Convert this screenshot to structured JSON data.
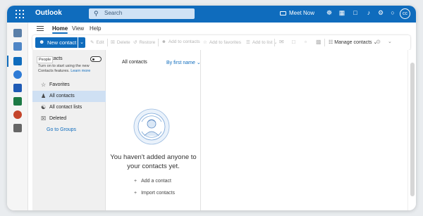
{
  "app": {
    "title": "Outlook",
    "search_placeholder": "Search",
    "meet_now_label": "Meet Now",
    "avatar_initials": "cc",
    "accent": "#0f6cbd"
  },
  "ribbon": {
    "tabs": [
      "Home",
      "View",
      "Help"
    ],
    "active_tab": "Home"
  },
  "toolbar": {
    "new_contact": "New contact",
    "edit": "Edit",
    "delete": "Delete",
    "restore": "Restore",
    "add_to_contacts": "Add to contacts",
    "add_to_favorites": "Add to favorites",
    "add_to_list": "Add to list",
    "manage_contacts": "Manage contacts"
  },
  "left_pane": {
    "people_tooltip": "People",
    "toggle_title": "ntacts",
    "toggle_desc_1": "Turn on to start using the new Contacts",
    "toggle_desc_2": "features.",
    "learn_more": "Learn more",
    "nav": [
      {
        "label": "Favorites",
        "icon": "star-icon"
      },
      {
        "label": "All contacts",
        "icon": "person-icon"
      },
      {
        "label": "All contact lists",
        "icon": "people-list-icon"
      },
      {
        "label": "Deleted",
        "icon": "trash-icon"
      }
    ],
    "selected": "All contacts",
    "groups_link": "Go to Groups"
  },
  "list_pane": {
    "title": "All contacts",
    "sort": "By first name",
    "empty_line1": "You haven't added anyone to",
    "empty_line2": "your contacts yet.",
    "actions": [
      "Add a contact",
      "Import contacts"
    ]
  }
}
